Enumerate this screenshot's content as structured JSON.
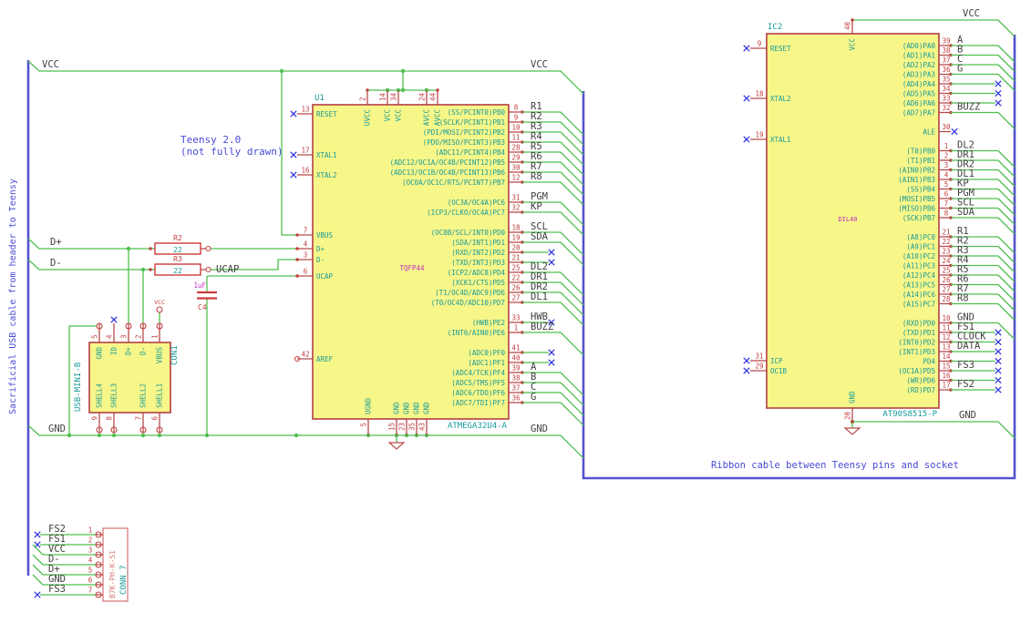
{
  "colors": {
    "wire": "#4fbf4f",
    "bus": "#5353cf",
    "note": "#4a4ad6",
    "comp": "#b84a4a",
    "fill": "#f6f689",
    "pnum": "#c23e3e",
    "cyan": "#189a9a",
    "lbl": "#3f3f3f",
    "mag": "#c02ec0",
    "nc": "#3333dd",
    "salmon": "#d97b7b",
    "res": "#cd3a3a"
  },
  "notes": {
    "sacrificial": "Sacrificial USB cable from header to Teensy",
    "teensy1": "Teensy 2.0",
    "teensy2": "(not fully drawn)",
    "ribbon": "Ribbon cable between Teensy pins and socket"
  },
  "labels": {
    "vcc_left": "VCC",
    "vcc_right": "VCC",
    "dplus": "D+",
    "dminus": "D-",
    "gnd_left": "GND",
    "gnd_right": "GND",
    "ucap": "UCAP",
    "vcc_ic2": "VCC",
    "gnd_ic2": "GND",
    "vcc_sym": "VCC"
  },
  "u1": {
    "ref": "U1",
    "value": "ATMEGA32U4-A",
    "footprint": "TQFP44",
    "top": [
      {
        "num": "2",
        "name": "UVCC"
      },
      {
        "num": "14",
        "name": "VCC"
      },
      {
        "num": "34",
        "name": "VCC"
      },
      {
        "num": "24",
        "name": "AVCC"
      },
      {
        "num": "44",
        "name": "AVCC"
      }
    ],
    "left": [
      {
        "num": "13",
        "name": "RESET",
        "conn": "ncpin"
      },
      {
        "num": "17",
        "name": "XTAL1",
        "conn": "ncpin"
      },
      {
        "num": "16",
        "name": "XTAL2",
        "conn": "ncpin"
      },
      {
        "num": "7",
        "name": "VBUS",
        "conn": "none"
      },
      {
        "num": "4",
        "name": "D+",
        "conn": "none"
      },
      {
        "num": "3",
        "name": "D-",
        "conn": "none"
      },
      {
        "num": "6",
        "name": "UCAP",
        "conn": "none"
      },
      {
        "num": "42",
        "name": "AREF",
        "conn": "open"
      }
    ],
    "right": [
      {
        "num": "8",
        "name": "(SS/PCINT0)PB0",
        "net": "R1",
        "conn": "bus"
      },
      {
        "num": "9",
        "name": "(SCLK/PCINT1)PB1",
        "net": "R2",
        "conn": "bus"
      },
      {
        "num": "10",
        "name": "(PDI/MOSI/PCINT2)PB2",
        "net": "R3",
        "conn": "bus"
      },
      {
        "num": "11",
        "name": "(PDO/MISO/PCINT3)PB3",
        "net": "R4",
        "conn": "bus"
      },
      {
        "num": "28",
        "name": "(ADC11/PCINT4)PB4",
        "net": "R5",
        "conn": "bus"
      },
      {
        "num": "29",
        "name": "(ADC12/OC1A/OC4B/PCINT12)PB5",
        "net": "R6",
        "conn": "bus"
      },
      {
        "num": "30",
        "name": "(ADC13/OC1B/OC4B/PCINT13)PB6",
        "net": "R7",
        "conn": "bus"
      },
      {
        "num": "12",
        "name": "(OC0A/OC1C/RTS/PCINT7)PB7",
        "net": "R8",
        "conn": "bus"
      },
      {
        "num": "31",
        "name": "(OC3A/OC4A)PC6",
        "net": "PGM",
        "conn": "bus"
      },
      {
        "num": "32",
        "name": "(ICP3/CLKO/OC4A)PC7",
        "net": "KP",
        "conn": "bus"
      },
      {
        "num": "18",
        "name": "(OC0B/SCL/INT0)PD0",
        "net": "SCL",
        "conn": "bus"
      },
      {
        "num": "19",
        "name": "(SDA/INT1)PD1",
        "net": "SDA",
        "conn": "bus"
      },
      {
        "num": "20",
        "name": "(RXD/INT2)PD2",
        "conn": "nc"
      },
      {
        "num": "21",
        "name": "(TXD/INT3)PD3",
        "conn": "nc"
      },
      {
        "num": "25",
        "name": "(ICP2/ADC8)PD4",
        "net": "DL2",
        "conn": "bus"
      },
      {
        "num": "22",
        "name": "(XCK1/CTS)PD5",
        "net": "DR1",
        "conn": "bus"
      },
      {
        "num": "26",
        "name": "(T1/OC4D/ADC9)PD6",
        "net": "DR2",
        "conn": "bus"
      },
      {
        "num": "27",
        "name": "(T0/OC4D/ADC10)PD7",
        "net": "DL1",
        "conn": "bus"
      },
      {
        "num": "33",
        "name": "(HWB)PE2",
        "net": "HWB",
        "conn": "nclabel"
      },
      {
        "num": "1",
        "name": "(INT6/AIN0)PE6",
        "net": "BUZZ",
        "conn": "bus"
      },
      {
        "num": "41",
        "name": "(ADC0)PF0",
        "conn": "nc"
      },
      {
        "num": "40",
        "name": "(ADC1)PF1",
        "conn": "nc"
      },
      {
        "num": "39",
        "name": "(ADC4/TCK)PF4",
        "net": "A",
        "conn": "bus"
      },
      {
        "num": "38",
        "name": "(ADC5/TMS)PF5",
        "net": "B",
        "conn": "bus"
      },
      {
        "num": "37",
        "name": "(ADC6/TDO)PF6",
        "net": "C",
        "conn": "bus"
      },
      {
        "num": "36",
        "name": "(ADC7/TDI)PF7",
        "net": "G",
        "conn": "bus"
      }
    ],
    "bottom": [
      {
        "num": "5",
        "name": "UGND"
      },
      {
        "num": "15",
        "name": "GND"
      },
      {
        "num": "23",
        "name": "GND"
      },
      {
        "num": "35",
        "name": "GND"
      },
      {
        "num": "43",
        "name": "GND"
      }
    ]
  },
  "ic2": {
    "ref": "IC2",
    "value": "AT90S8515-P",
    "footprint": "DIL40",
    "top": [
      {
        "num": "40",
        "name": "VCC"
      }
    ],
    "left": [
      {
        "num": "9",
        "name": "RESET",
        "conn": "ncpin"
      },
      {
        "num": "18",
        "name": "XTAL2",
        "conn": "ncpin"
      },
      {
        "num": "19",
        "name": "XTAL1",
        "conn": "ncpin"
      },
      {
        "num": "31",
        "name": "ICP",
        "conn": "ncpin"
      },
      {
        "num": "29",
        "name": "OC1B",
        "conn": "ncpin"
      }
    ],
    "right": [
      {
        "num": "39",
        "name": "(AD0)PA0",
        "net": "A",
        "conn": "bus"
      },
      {
        "num": "38",
        "name": "(AD1)PA1",
        "net": "B",
        "conn": "bus"
      },
      {
        "num": "37",
        "name": "(AD2)PA2",
        "net": "C",
        "conn": "bus"
      },
      {
        "num": "36",
        "name": "(AD3)PA3",
        "net": "G",
        "conn": "bus"
      },
      {
        "num": "35",
        "name": "(AD4)PA4",
        "conn": "nc"
      },
      {
        "num": "34",
        "name": "(AD5)PA5",
        "conn": "nc"
      },
      {
        "num": "33",
        "name": "(AD6)PA6",
        "conn": "nc"
      },
      {
        "num": "32",
        "name": "(AD7)PA7",
        "net": "BUZZ",
        "conn": "bus"
      },
      {
        "num": "30",
        "name": "ALE",
        "conn": "ncpin"
      },
      {
        "num": "1",
        "name": "(T0)PB0",
        "net": "DL2",
        "conn": "bus"
      },
      {
        "num": "2",
        "name": "(T1)PB1",
        "net": "DR1",
        "conn": "bus"
      },
      {
        "num": "3",
        "name": "(AIN0)PB2",
        "net": "DR2",
        "conn": "bus"
      },
      {
        "num": "4",
        "name": "(AIN1)PB3",
        "net": "DL1",
        "conn": "bus"
      },
      {
        "num": "5",
        "name": "(SS)PB4",
        "net": "KP",
        "conn": "bus"
      },
      {
        "num": "6",
        "name": "(MOSI)PB5",
        "net": "PGM",
        "conn": "bus"
      },
      {
        "num": "7",
        "name": "(MISO)PB6",
        "net": "SCL",
        "conn": "bus"
      },
      {
        "num": "8",
        "name": "(SCK)PB7",
        "net": "SDA",
        "conn": "bus"
      },
      {
        "num": "21",
        "name": "(A8)PC0",
        "net": "R1",
        "conn": "bus"
      },
      {
        "num": "22",
        "name": "(A9)PC1",
        "net": "R2",
        "conn": "bus"
      },
      {
        "num": "23",
        "name": "(A10)PC2",
        "net": "R3",
        "conn": "bus"
      },
      {
        "num": "24",
        "name": "(A11)PC3",
        "net": "R4",
        "conn": "bus"
      },
      {
        "num": "25",
        "name": "(A12)PC4",
        "net": "R5",
        "conn": "bus"
      },
      {
        "num": "26",
        "name": "(A13)PC5",
        "net": "R6",
        "conn": "bus"
      },
      {
        "num": "27",
        "name": "(A14)PC6",
        "net": "R7",
        "conn": "bus"
      },
      {
        "num": "28",
        "name": "(A15)PC7",
        "net": "R8",
        "conn": "bus"
      },
      {
        "num": "10",
        "name": "(RXD)PD0",
        "net": "GND",
        "conn": "bus"
      },
      {
        "num": "11",
        "name": "(TXD)PD1",
        "net": "FS1",
        "conn": "nclabel"
      },
      {
        "num": "12",
        "name": "(INT0)PD2",
        "net": "CLOCK",
        "conn": "nclabel"
      },
      {
        "num": "13",
        "name": "(INT1)PD3",
        "net": "DATA",
        "conn": "nclabel"
      },
      {
        "num": "14",
        "name": "PD4",
        "conn": "nc"
      },
      {
        "num": "15",
        "name": "(OC1A)PD5",
        "net": "FS3",
        "conn": "nclabel"
      },
      {
        "num": "16",
        "name": "(WR)PD6",
        "conn": "nc"
      },
      {
        "num": "17",
        "name": "(RD)PD7",
        "net": "FS2",
        "conn": "nclabel"
      }
    ],
    "bottom": [
      {
        "num": "20",
        "name": "GND"
      }
    ]
  },
  "con1": {
    "ref": "CON1",
    "value": "USB-MINI-B",
    "top": [
      {
        "num": "5",
        "name": "GND",
        "conn": "none"
      },
      {
        "num": "4",
        "name": "ID",
        "conn": "ncpin"
      },
      {
        "num": "3",
        "name": "D+",
        "conn": "none"
      },
      {
        "num": "2",
        "name": "D-",
        "conn": "none"
      },
      {
        "num": "1",
        "name": "VBUS",
        "conn": "none"
      }
    ],
    "bottom": [
      {
        "num": "9",
        "name": "SHELL4"
      },
      {
        "num": "8",
        "name": "SHELL3"
      },
      {
        "num": "7",
        "name": "SHELL2"
      },
      {
        "num": "6",
        "name": "SHELL1"
      }
    ]
  },
  "conn7": {
    "ref": "CONN_7",
    "value": "B7K-PH-K-S1",
    "pins": [
      {
        "num": "1",
        "net": "FS2",
        "conn": "nc"
      },
      {
        "num": "2",
        "net": "FS1",
        "conn": "nc"
      },
      {
        "num": "3",
        "net": "VCC",
        "conn": "bus"
      },
      {
        "num": "4",
        "net": "D-",
        "conn": "bus"
      },
      {
        "num": "5",
        "net": "D+",
        "conn": "bus"
      },
      {
        "num": "6",
        "net": "GND",
        "conn": "bus"
      },
      {
        "num": "7",
        "net": "FS3",
        "conn": "nc"
      }
    ]
  },
  "r2": {
    "ref": "R2",
    "value": "22"
  },
  "r3": {
    "ref": "R3",
    "value": "22"
  },
  "c4": {
    "ref": "C4",
    "value": "1uF"
  }
}
